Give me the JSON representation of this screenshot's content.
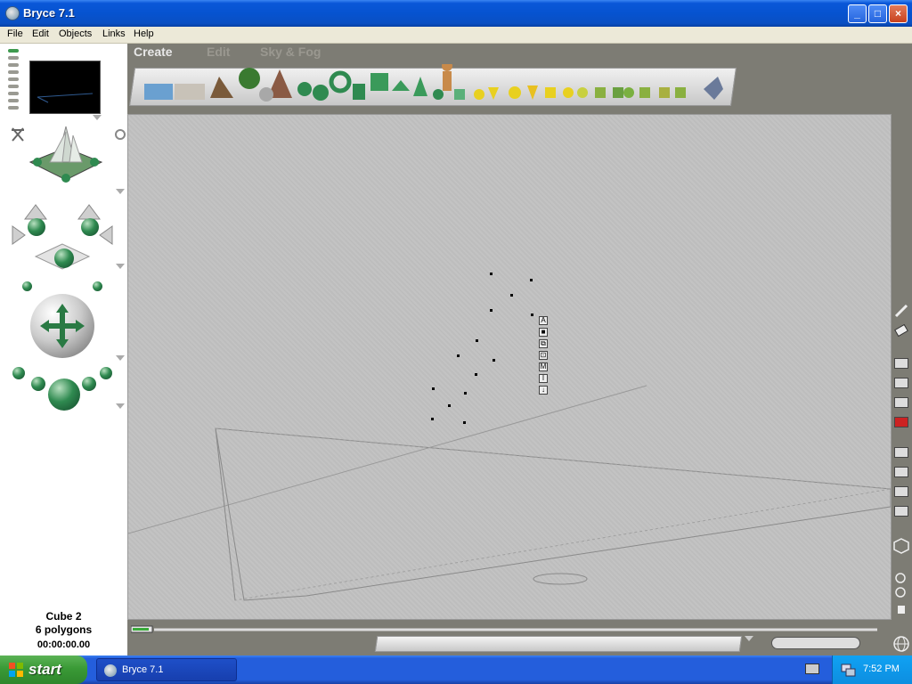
{
  "window": {
    "title": "Bryce 7.1",
    "minimize": "_",
    "maximize": "□",
    "close": "×"
  },
  "menu": [
    "File",
    "Edit",
    "Objects",
    "Links",
    "Help"
  ],
  "tabs": {
    "create": "Create",
    "edit": "Edit",
    "sky_fog": "Sky & Fog"
  },
  "object_info": {
    "name": "Cube 2",
    "polygons": "6 polygons",
    "time": "00:00:00.00"
  },
  "mini_toolbar": [
    "A",
    "■",
    "⧉",
    "⊡",
    "M",
    "I",
    "↓"
  ],
  "taskbar": {
    "start": "start",
    "task_item": "Bryce 7.1",
    "clock": "7:52 PM"
  },
  "colors": {
    "accent_green": "#2f8a50",
    "taskbar_blue": "#245edc",
    "start_green": "#3a9a36"
  },
  "icons": {
    "window": "bryce-app-icon",
    "globe": "globe-icon"
  }
}
